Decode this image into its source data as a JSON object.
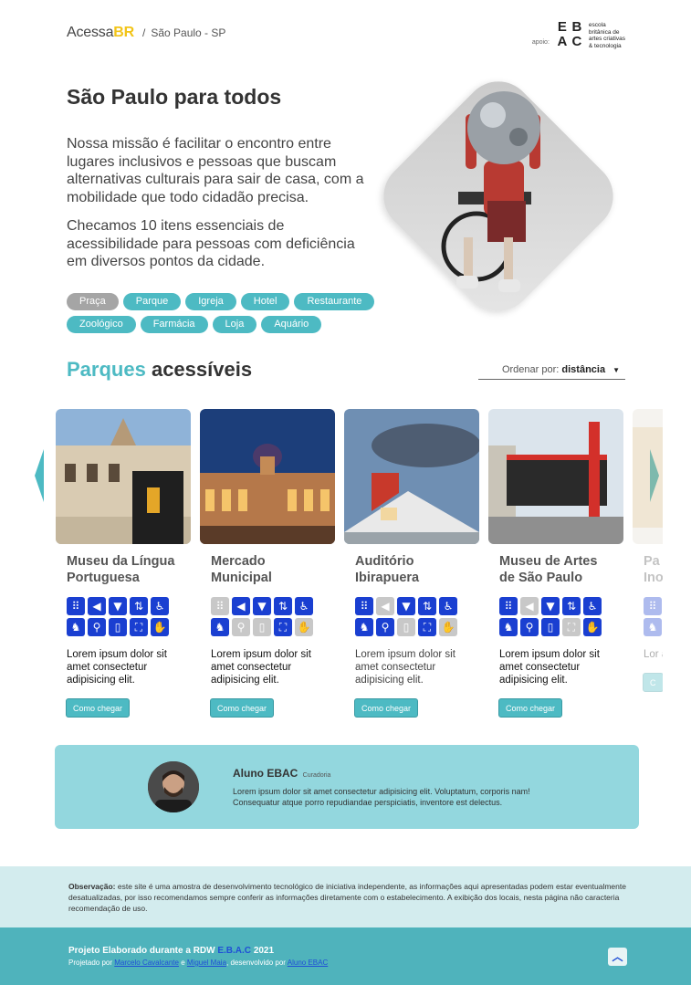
{
  "header": {
    "brand_main": "Acessa",
    "brand_accent": "BR",
    "separator": "/",
    "city": "São Paulo - SP",
    "apoio_label": "apoio:",
    "sponsor_lines": [
      "escola",
      "britânica de",
      "artes criativas",
      "& tecnologia"
    ],
    "sponsor_mark": [
      "E",
      "B",
      "A",
      "C"
    ]
  },
  "hero": {
    "title": "São Paulo para todos",
    "paragraph_1": "Nossa missão é facilitar o encontro entre lugares inclusivos e pessoas que buscam alternativas culturais para sair de casa, com a mobilidade que todo cidadão precisa.",
    "paragraph_2": "Checamos 10 itens essenciais de acessibilidade para pessoas com deficiência em diversos pontos da cidade."
  },
  "tags": [
    {
      "label": "Praça",
      "active": true
    },
    {
      "label": "Parque",
      "active": false
    },
    {
      "label": "Igreja",
      "active": false
    },
    {
      "label": "Hotel",
      "active": false
    },
    {
      "label": "Restaurante",
      "active": false
    },
    {
      "label": "Zoológico",
      "active": false
    },
    {
      "label": "Farmácia",
      "active": false
    },
    {
      "label": "Loja",
      "active": false
    },
    {
      "label": "Aquário",
      "active": false
    }
  ],
  "section": {
    "title_highlight": "Parques",
    "title_rest": "acessíveis",
    "sort_label": "Ordenar por:",
    "sort_value": "distância"
  },
  "cards": [
    {
      "name_line1": "Museu da Língua",
      "name_line2": "Portuguesa",
      "icons_off": [],
      "description": "Lorem ipsum dolor sit amet consectetur adipisicing elit.",
      "button": "Como chegar"
    },
    {
      "name_line1": "Mercado",
      "name_line2": "Municipal",
      "icons_off": [
        0,
        6,
        7,
        9
      ],
      "description": "Lorem ipsum dolor sit amet consectetur adipisicing elit.",
      "button": "Como chegar"
    },
    {
      "name_line1": "Auditório",
      "name_line2": "Ibirapuera",
      "icons_off": [
        1,
        7,
        9
      ],
      "description": "Lorem ipsum dolor sit amet consectetur adipisicing elit.",
      "button": "Como chegar"
    },
    {
      "name_line1": "Museu de Artes",
      "name_line2": "de São Paulo",
      "icons_off": [
        1,
        8
      ],
      "description": "Lorem ipsum dolor sit amet consectetur adipisicing elit.",
      "button": "Como chegar"
    },
    {
      "name_line1": "Pa",
      "name_line2": "Ino",
      "icons_off": [],
      "description": "Lor am adip",
      "button": "C"
    }
  ],
  "icon_names": [
    "braille-icon",
    "audio-icon",
    "toilet-icon",
    "elevator-icon",
    "wheelchair-icon",
    "guide-dog-icon",
    "walking-cane-icon",
    "door-icon",
    "ramp-icon",
    "sign-language-icon"
  ],
  "icon_glyphs": [
    "⠿",
    "◀",
    "▼",
    "⇅",
    "♿",
    "♞",
    "⚲",
    "▯",
    "⛶",
    "✋"
  ],
  "curator": {
    "name": "Aluno EBAC",
    "role": "Curadoria",
    "text": "Lorem ipsum dolor sit amet consectetur adipisicing elit. Voluptatum, corporis nam! Consequatur atque porro repudiandae perspiciatis, inventore est delectus."
  },
  "observation": {
    "label": "Observação:",
    "text": "este site é uma amostra de desenvolvimento tecnológico de iniciativa independente, as informações aqui apresentadas podem estar eventualmente desatualizadas, por isso recomendamos sempre conferir as informações diretamente com o estabelecimento. A exibição dos locais, nesta página não caracteria recomendação de uso."
  },
  "footer": {
    "title_prefix": "Projeto Elaborado durante a RDW",
    "title_ebac": "E.B.A.C",
    "title_year": "2021",
    "credits_prefix": "Projetado por",
    "author_1": "Marcelo Cavalcante",
    "and": "e",
    "author_2": "Miguel Maia",
    "credits_mid": ", desenvolvido por",
    "developer": "Aluno EBAC"
  },
  "colors": {
    "accent": "#4dbac3",
    "brand_yellow": "#f2c418",
    "icon_blue": "#1a3fd1",
    "footer": "#4fb3bc"
  }
}
